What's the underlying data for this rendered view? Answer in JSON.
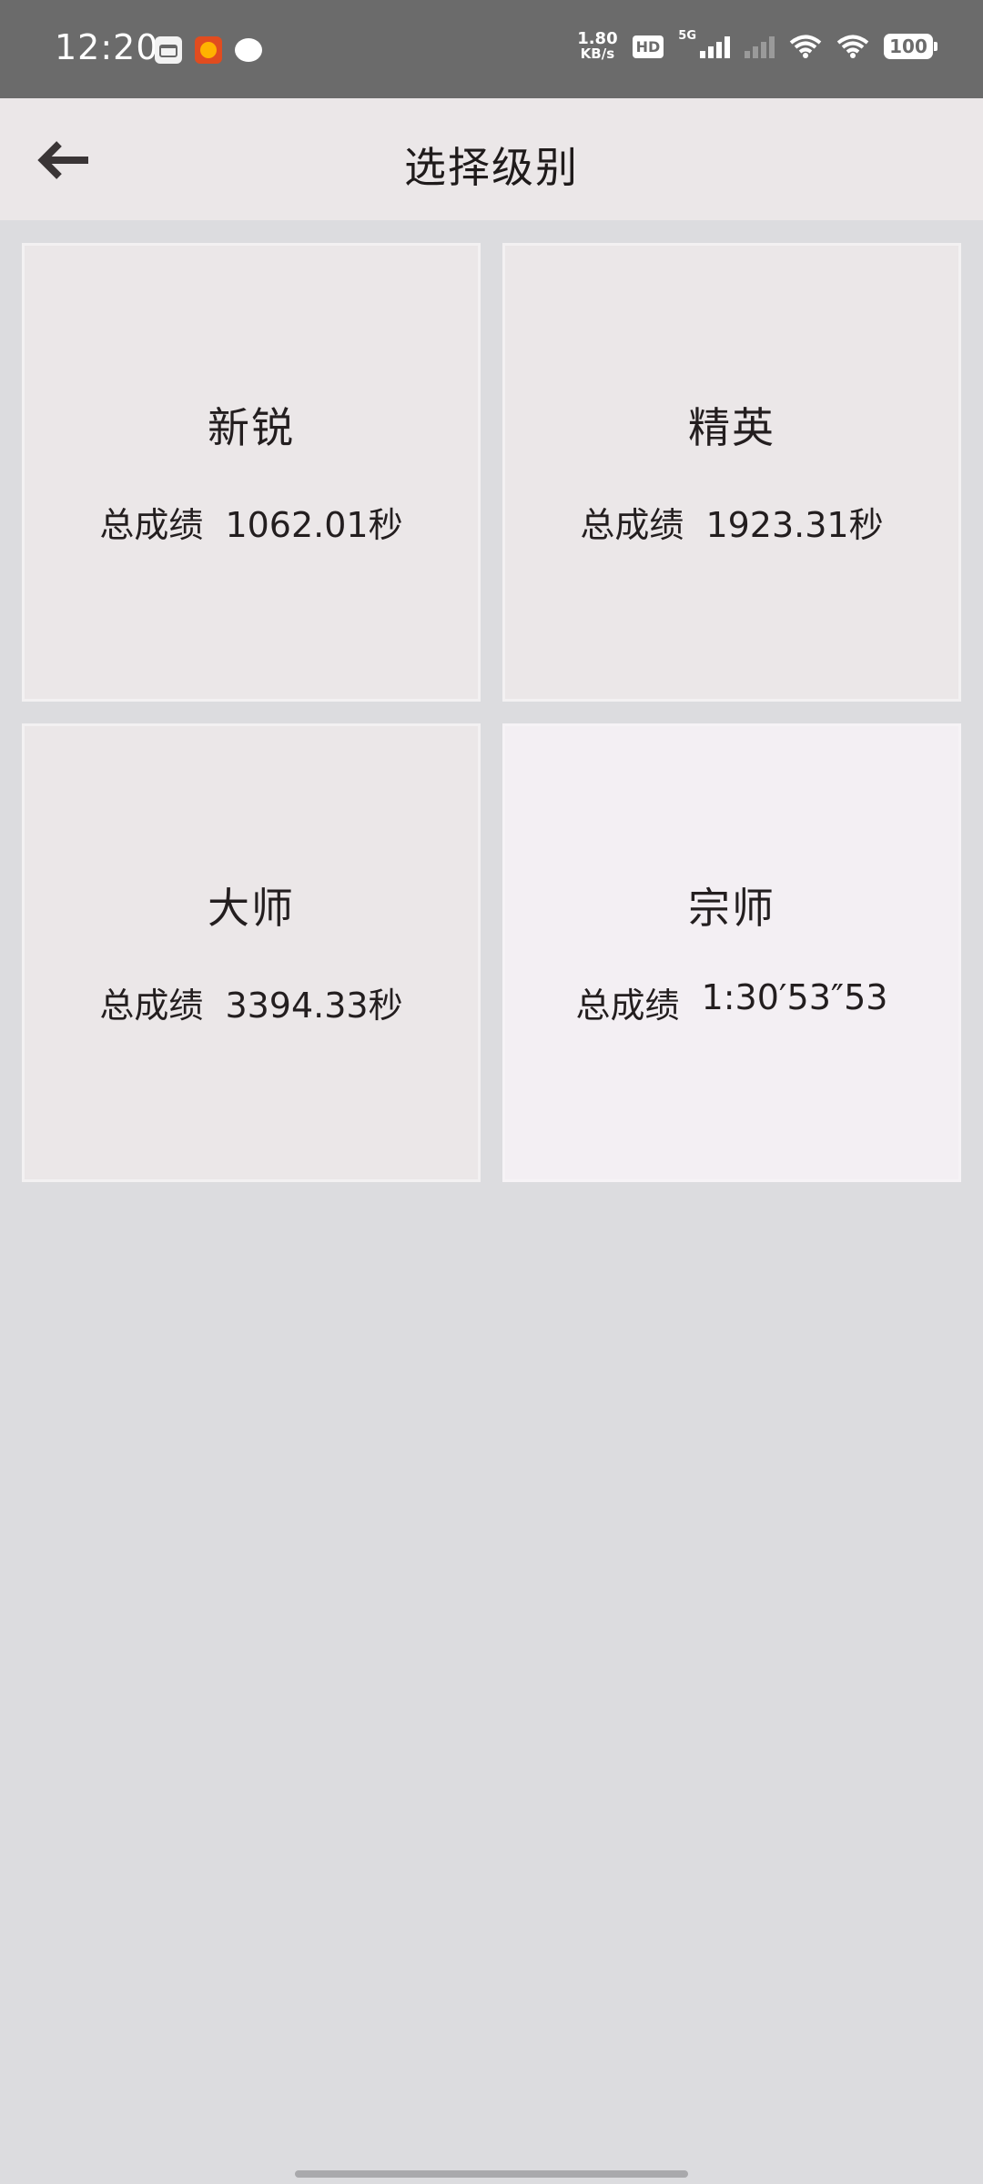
{
  "status_bar": {
    "time": "12:20",
    "net_speed_value": "1.80",
    "net_speed_unit": "KB/s",
    "hd_label": "HD",
    "signal_label": "5G",
    "battery": "100"
  },
  "app_bar": {
    "title": "选择级别"
  },
  "levels": [
    {
      "name": "新锐",
      "score_label": "总成绩",
      "score_value": "1062.01秒"
    },
    {
      "name": "精英",
      "score_label": "总成绩",
      "score_value": "1923.31秒"
    },
    {
      "name": "大师",
      "score_label": "总成绩",
      "score_value": "3394.33秒"
    },
    {
      "name": "宗师",
      "score_label": "总成绩",
      "score_value": "1:30′53″53"
    }
  ],
  "colors": {
    "status_bar_bg": "#6b6b6b",
    "app_bar_bg": "#ebe7e8",
    "page_bg": "#dcdcdf",
    "card_bg": "#ebe7e8",
    "card_highlight_bg": "#f3eff3",
    "text": "#231e1f"
  }
}
